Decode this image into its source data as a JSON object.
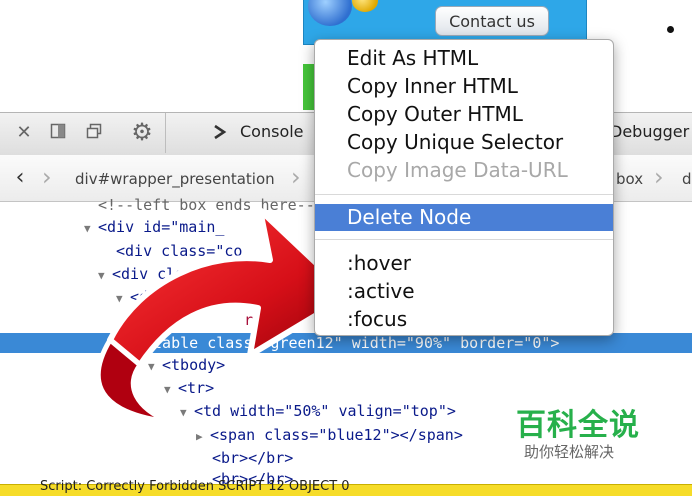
{
  "webpage": {
    "contact_button": "Contact us"
  },
  "toolbar": {
    "console_label": "Console",
    "debugger_label": "Debugger"
  },
  "breadcrumb": {
    "item1": "div#wrapper_presentation",
    "item2": "box",
    "item3": "d"
  },
  "tree": {
    "lines": [
      {
        "indent": 98,
        "twisty": "",
        "html": "<!--left box ends here-->"
      },
      {
        "indent": 84,
        "twisty": "▼",
        "html": "<div id=\"main_"
      },
      {
        "indent": 112,
        "twisty": "",
        "html": "<div class=\"co"
      },
      {
        "indent": 98,
        "twisty": "▼",
        "html": "<div class=\"b"
      },
      {
        "indent": 112,
        "twisty": "▼",
        "html": "<div st"
      },
      {
        "indent": 130,
        "twisty": "▶",
        "html": "right"
      }
    ],
    "selected": {
      "tag": "<table",
      "attrs": " class=\"green12\" width=\"90%\" border=\"0\">"
    },
    "after": [
      {
        "indent": 148,
        "twisty": "▼",
        "html": "<tbody>"
      },
      {
        "indent": 164,
        "twisty": "▼",
        "html": "<tr>"
      },
      {
        "indent": 180,
        "twisty": "▼",
        "html": "<td width=\"50%\" valign=\"top\">"
      },
      {
        "indent": 196,
        "twisty": "▶",
        "html": "<span class=\"blue12\"></span>"
      },
      {
        "indent": 212,
        "twisty": "",
        "html": "<br></br>"
      },
      {
        "indent": 212,
        "twisty": "",
        "html": "<br></br>"
      }
    ]
  },
  "status": {
    "text": "Script: Correctly Forbidden  SCRIPT 12  OBJECT 0"
  },
  "context_menu": {
    "items": [
      "Edit As HTML",
      "Copy Inner HTML",
      "Copy Outer HTML",
      "Copy Unique Selector",
      "Copy Image Data-URL",
      "Delete Node",
      ":hover",
      ":active",
      ":focus"
    ],
    "highlighted": "Delete Node",
    "disabled": "Copy Image Data-URL"
  },
  "watermark": {
    "title": "百科全说",
    "subtitle": "助你轻松解决"
  },
  "colors": {
    "menu_highlight": "#4a7fd6",
    "selected_row": "#3a89d6",
    "arrow": "#e0101a",
    "status_bar": "#f6dc29",
    "watermark_green": "#27b04b"
  },
  "icons": [
    "close-icon",
    "dock-side-icon",
    "dock-window-icon",
    "settings-icon",
    "console-icon",
    "back-icon",
    "arrow-graphic"
  ]
}
